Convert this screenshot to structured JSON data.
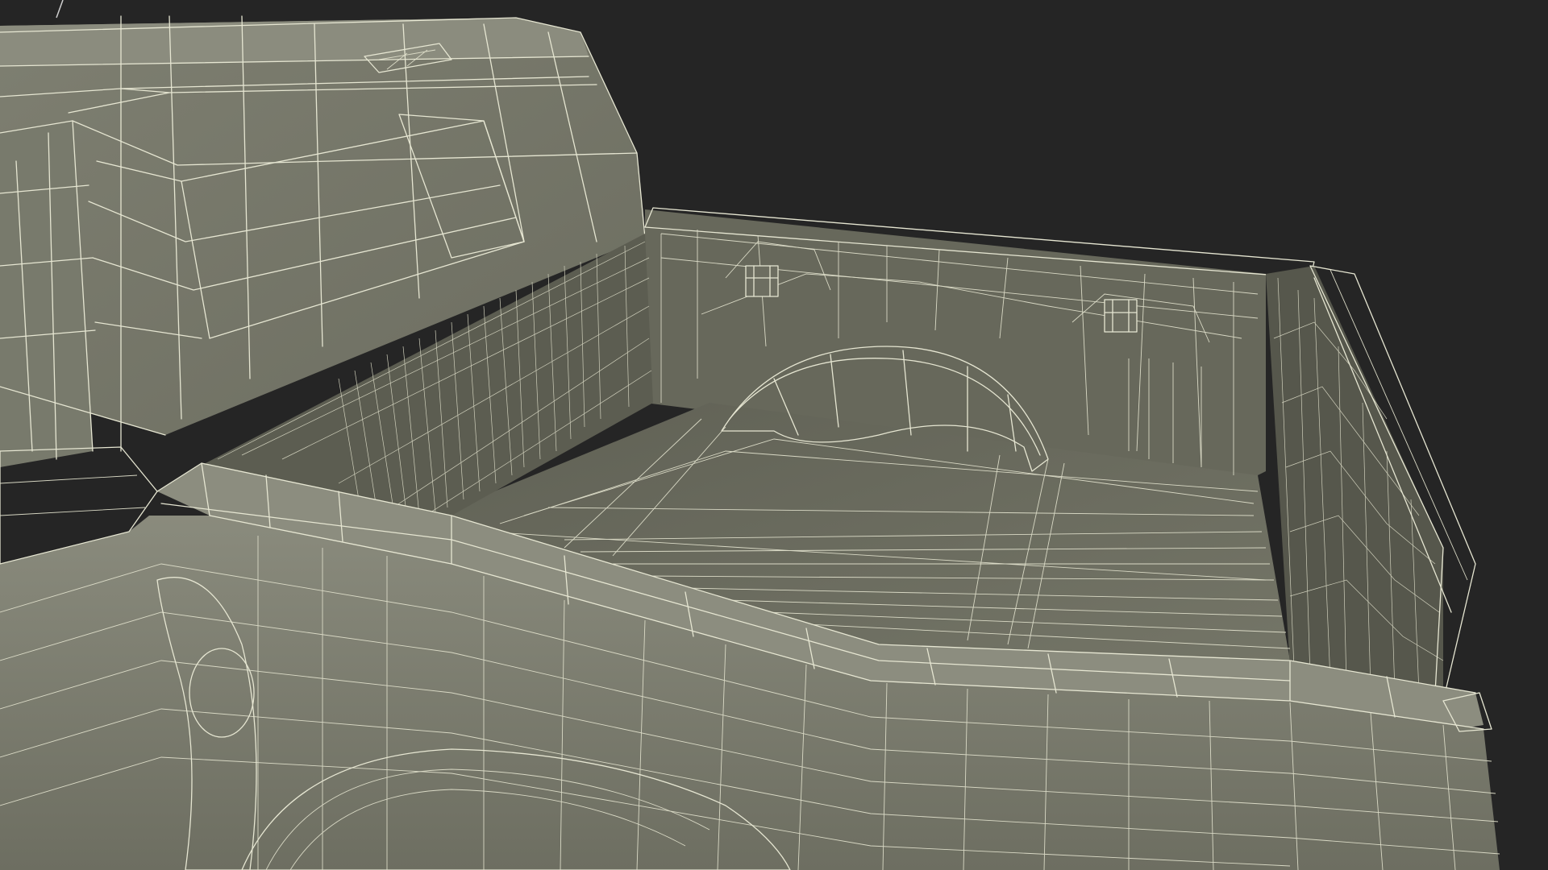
{
  "scene": {
    "subject": "",
    "background_color": "#252525",
    "surface_colors": {
      "body": "#7a7b6b",
      "body_light": "#87887a",
      "body_dark": "#5f6054",
      "bed_floor": "#6e6f62",
      "bed_wall_far": "#66675a",
      "bed_wall_side": "#5b5c51",
      "shadow": "#4d4e45",
      "wire": "#e6e6d2"
    }
  }
}
